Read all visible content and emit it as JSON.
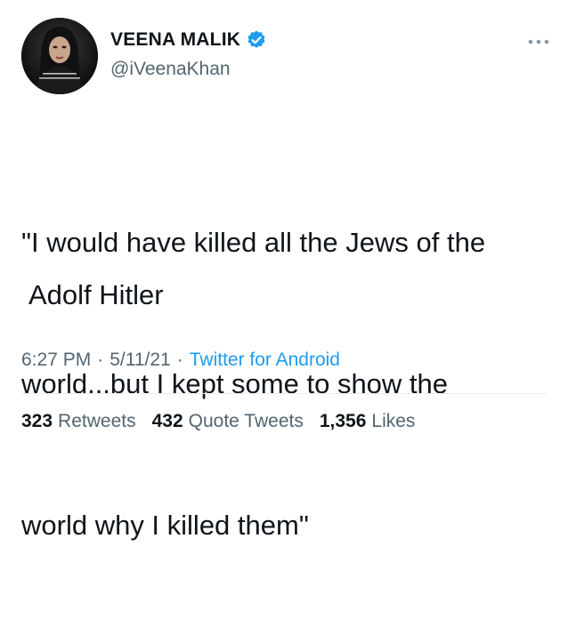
{
  "author": {
    "display_name": "VEENA MALIK",
    "handle": "@iVeenaKhan",
    "verified": true,
    "avatar": "profile-photo"
  },
  "tweet": {
    "lines": [
      "\"I would have killed all the Jews of the",
      "world...but I kept some to show the",
      "world why I killed them\""
    ],
    "attribution": "Adolf Hitler"
  },
  "meta": {
    "time": "6:27 PM",
    "separator": "·",
    "date": "5/11/21",
    "source": "Twitter for Android"
  },
  "stats": {
    "retweets_count": "323",
    "retweets_label": "Retweets",
    "quote_count": "432",
    "quote_label": "Quote Tweets",
    "likes_count": "1,356",
    "likes_label": "Likes"
  },
  "colors": {
    "accent": "#1d9bf0",
    "text": "#0f1419",
    "muted": "#536471"
  },
  "icons": {
    "verified": "verified-badge-icon",
    "more": "more-options-icon"
  }
}
